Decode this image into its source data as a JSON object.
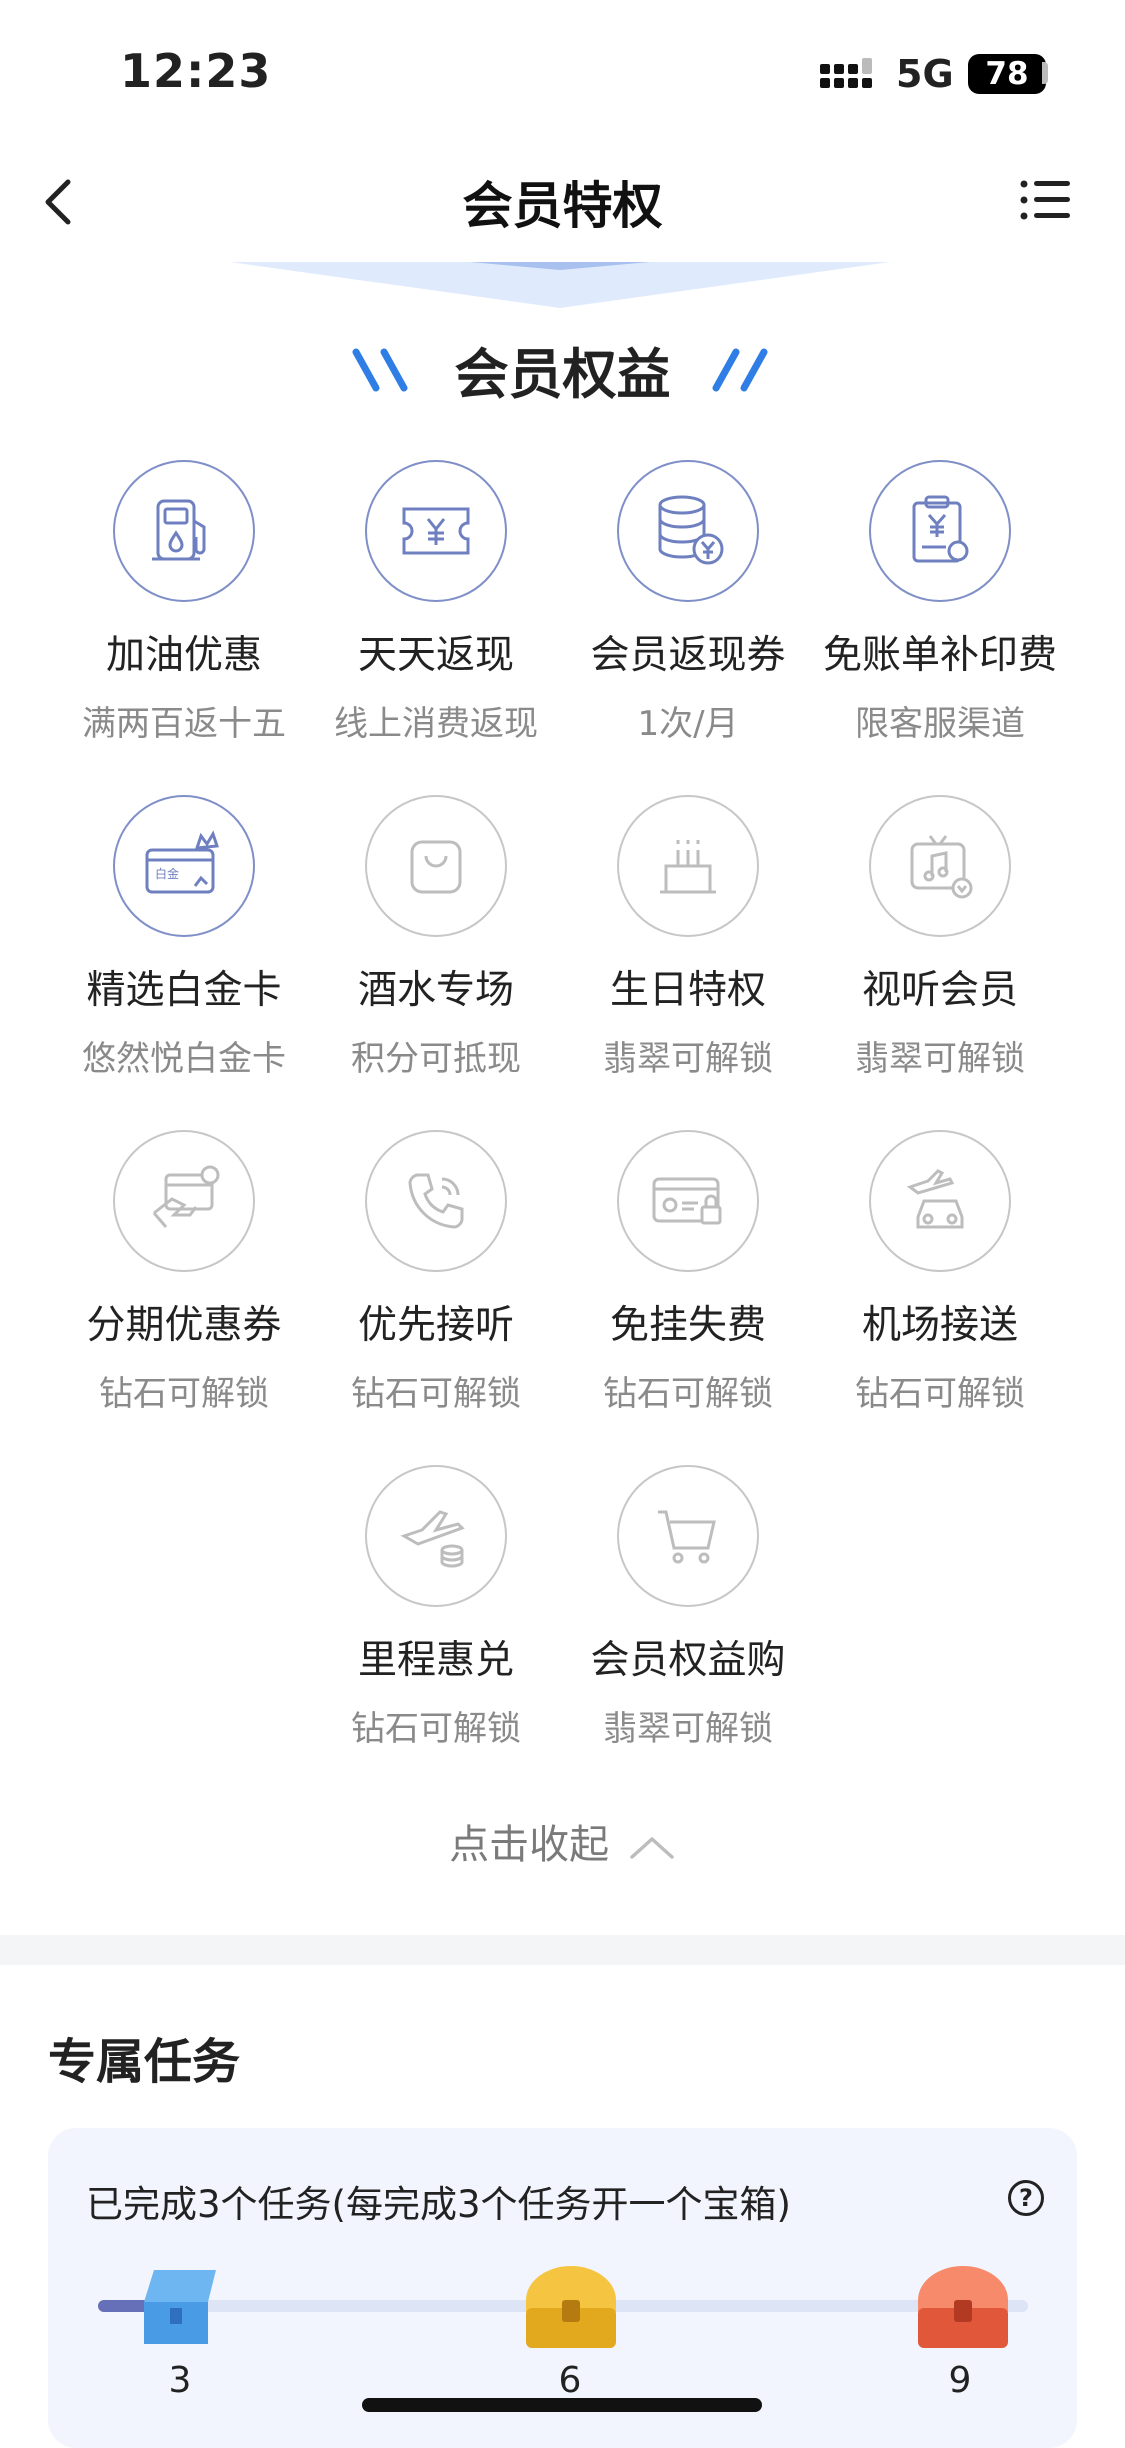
{
  "status_bar": {
    "time": "12:23",
    "network": "5G",
    "battery": "78"
  },
  "nav": {
    "title": "会员特权"
  },
  "section": {
    "title": "会员权益"
  },
  "benefits": [
    {
      "title": "加油优惠",
      "sub": "满两百返十五",
      "icon": "fuel-pump-icon",
      "active": true
    },
    {
      "title": "天天返现",
      "sub": "线上消费返现",
      "icon": "ticket-yuan-icon",
      "active": true
    },
    {
      "title": "会员返现券",
      "sub": "1次/月",
      "icon": "coin-stack-yuan-icon",
      "active": true
    },
    {
      "title": "免账单补印费",
      "sub": "限客服渠道",
      "icon": "bill-clipboard-icon",
      "active": true
    },
    {
      "title": "精选白金卡",
      "sub": "悠然悦白金卡",
      "icon": "platinum-card-icon",
      "active": true,
      "card_text": "白金"
    },
    {
      "title": "酒水专场",
      "sub": "积分可抵现",
      "icon": "shopping-bag-icon",
      "active": false
    },
    {
      "title": "生日特权",
      "sub": "翡翠可解锁",
      "icon": "birthday-cake-icon",
      "active": false
    },
    {
      "title": "视听会员",
      "sub": "翡翠可解锁",
      "icon": "tv-music-icon",
      "active": false
    },
    {
      "title": "分期优惠券",
      "sub": "钻石可解锁",
      "icon": "card-hand-icon",
      "active": false
    },
    {
      "title": "优先接听",
      "sub": "钻石可解锁",
      "icon": "phone-icon",
      "active": false
    },
    {
      "title": "免挂失费",
      "sub": "钻石可解锁",
      "icon": "card-lock-icon",
      "active": false
    },
    {
      "title": "机场接送",
      "sub": "钻石可解锁",
      "icon": "airport-car-icon",
      "active": false
    },
    {
      "title": "里程惠兑",
      "sub": "钻石可解锁",
      "icon": "plane-coins-icon",
      "active": false
    },
    {
      "title": "会员权益购",
      "sub": "翡翠可解锁",
      "icon": "shopping-cart-icon",
      "active": false
    }
  ],
  "collapse": {
    "label": "点击收起"
  },
  "tasks": {
    "title": "专属任务",
    "desc": "已完成3个任务(每完成3个任务开一个宝箱)",
    "progress": 0.08,
    "milestones": [
      "3",
      "6",
      "9"
    ],
    "chest_colors": [
      "#4a9be6",
      "#f0b429",
      "#ef6a4c"
    ]
  }
}
